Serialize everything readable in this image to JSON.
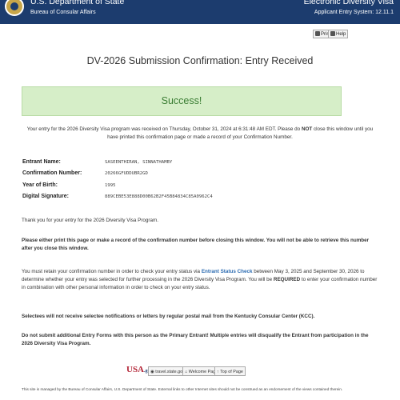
{
  "header": {
    "department": "U.S. Department of State",
    "bureau": "Bureau of Consular Affairs",
    "app_title": "Electronic Diversity Visa",
    "app_system": "Applicant Entry System: 12.11.1"
  },
  "toolbar": {
    "print_label": "Print",
    "help_label": "Help"
  },
  "page": {
    "title": "DV-2026 Submission Confirmation: Entry Received",
    "success_label": "Success!",
    "intro_before": "Your entry for the 2026 Diversity Visa program was received on Thursday, October 31, 2024 at 6:31:48 AM EDT. Please do ",
    "intro_bold": "NOT",
    "intro_after": " close this window until you have printed this confirmation page or made a record of your Confirmation Number."
  },
  "entrant": {
    "name_label": "Entrant Name:",
    "name_value": "SASEENTHIRAN, SINNATHAMBY",
    "confirmation_label": "Confirmation Number:",
    "confirmation_value": "20266GFUDDUBR2GD",
    "birth_label": "Year of Birth:",
    "birth_value": "1995",
    "signature_label": "Digital Signature:",
    "signature_value": "889CEBE53E888D00B62B2F45B84834C85A0962C4"
  },
  "messages": {
    "thanks": "Thank you for your entry for the 2026 Diversity Visa Program.",
    "print_warning": "Please either print this page or make a record of the confirmation number before closing this window. You will not be able to retrieve this number after you close this window.",
    "retain_before": "You must retain your confirmation number in order to check your entry status via ",
    "retain_link": "Entrant Status Check",
    "retain_middle": " between May 3, 2025 and September 30, 2026 to determine whether your entry was selected for further processing in the 2026 Diversity Visa Program. You will be ",
    "retain_required": "REQUIRED",
    "retain_after": " to enter your confirmation number in combination with other personal information in order to check on your entry status.",
    "selectees": "Selectees will not receive selectee notifications or letters by regular postal mail from the Kentucky Consular Center (KCC).",
    "no_additional": "Do not submit additional Entry Forms with this person as the Primary Entrant! Multiple entries will disqualify the Entrant from participation in the 2026 Diversity Visa Program."
  },
  "footer": {
    "logo_text": "USA",
    "logo_suffix": ".gov",
    "travel_label": "travel.state.gov",
    "welcome_label": "Welcome Page",
    "top_label": "Top of Page",
    "note": "This site is managed by the Bureau of Consular Affairs, U.S. Department of State. External links to other Internet sites should not be construed as an endorsement of the views contained therein."
  },
  "colors": {
    "header_bg": "#1c3c6e",
    "success_bg": "#d6eec8",
    "success_text": "#3a7d33",
    "link": "#2a6ab0"
  },
  "icons": [
    "state-seal-icon",
    "print-icon",
    "help-icon",
    "globe-icon",
    "home-icon",
    "arrow-up-icon"
  ]
}
